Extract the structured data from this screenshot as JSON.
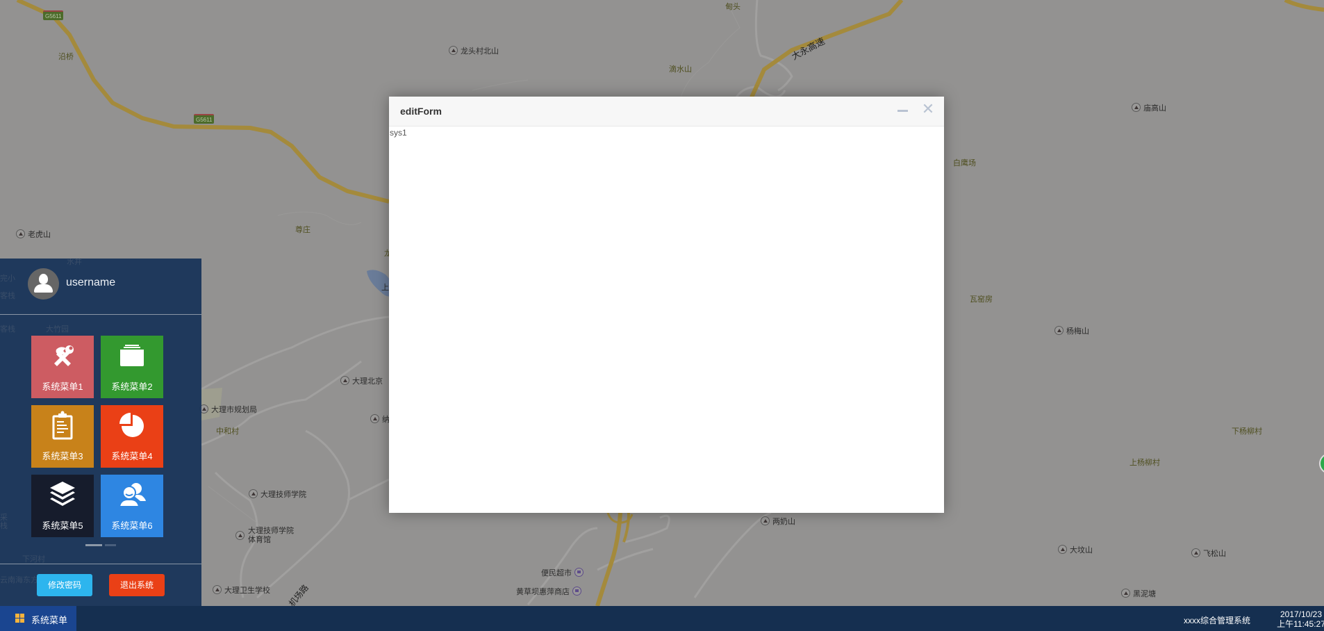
{
  "map": {
    "highway_shields": [
      "G5611",
      "G5611"
    ],
    "road_labels": {
      "expressway": "大永高速",
      "airport_road": "机场路"
    },
    "village_labels": [
      "沿桥",
      "甸头",
      "滴水山",
      "尊庄",
      "白鹰场",
      "瓦窑房",
      "中和村",
      "下杨柳村",
      "上杨柳村",
      "龙",
      "上"
    ],
    "poi_labels": [
      "龙头村北山",
      "老虎山",
      "庙高山",
      "杨梅山",
      "大理北京",
      "大理市规划局",
      "纳",
      "大理技师学院",
      "大理技师学院体育馆",
      "大理卫生学校",
      "两奶山",
      "大坟山",
      "飞松山",
      "黑泥塘",
      "便民超市",
      "黄草坝惠萍商店"
    ],
    "colors": {
      "background": "#939291",
      "highway": "#a48a3c",
      "water": "#6a7c99",
      "marker": "#2aa94a"
    }
  },
  "dialog": {
    "title": "editForm",
    "content": "sys1",
    "minimize_icon": "minimize-icon",
    "close_icon": "close-icon",
    "close_glyph": "✕"
  },
  "sidebar": {
    "username": "username",
    "avatar_icon": "user-icon",
    "tiles": [
      {
        "label": "系统菜单1",
        "icon": "tools-icon",
        "color": "#cd5c62"
      },
      {
        "label": "系统菜单2",
        "icon": "folder-icon",
        "color": "#33992f"
      },
      {
        "label": "系统菜单3",
        "icon": "clipboard-icon",
        "color": "#c8821a"
      },
      {
        "label": "系统菜单4",
        "icon": "pie-chart-icon",
        "color": "#ea4016"
      },
      {
        "label": "系统菜单5",
        "icon": "layers-icon",
        "color": "#161c2c"
      },
      {
        "label": "系统菜单6",
        "icon": "users-icon",
        "color": "#2e86e2"
      }
    ],
    "pager": {
      "pages": 2,
      "current": 1
    },
    "change_password_label": "修改密码",
    "logout_label": "退出系统",
    "faint_labels": [
      "水井",
      "完小",
      "客栈",
      "客栈",
      "大竹园",
      "采",
      "栈",
      "下河村",
      "云南海东方"
    ]
  },
  "taskbar": {
    "start_label": "系统菜单",
    "start_icon": "windows-icon",
    "app_name": "xxxx综合管理系统",
    "date": "2017/10/23",
    "time": "上午11:45:27"
  }
}
